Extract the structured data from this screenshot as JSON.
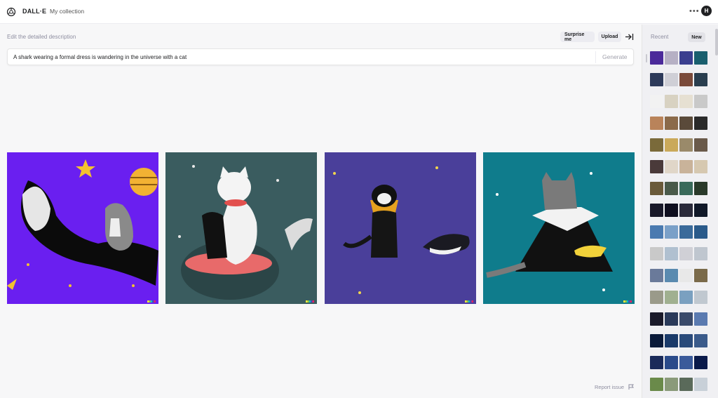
{
  "nav": {
    "brand": "DALL·E",
    "collection_link": "My collection",
    "avatar_initial": "H"
  },
  "editor": {
    "hint": "Edit the detailed description",
    "surprise_label": "Surprise me",
    "upload_label": "Upload",
    "prompt": "A shark wearing a formal dress is wandering in the universe with a cat",
    "generate_label": "Generate"
  },
  "results": [
    {
      "background": "#6a1ff0"
    },
    {
      "background": "#3a5c5f"
    },
    {
      "background": "#4a3f9a"
    },
    {
      "background": "#0f7c8c"
    }
  ],
  "footer": {
    "report_label": "Report issue"
  },
  "sidebar": {
    "recent_label": "Recent",
    "new_label": "New",
    "history_colors": [
      [
        "#4b2a9a",
        "#b6b0c4",
        "#3b3f8f",
        "#1a5f6e"
      ],
      [
        "#2d3a5a",
        "#cfcfd6",
        "#7a4a3a",
        "#2a3e4f"
      ],
      [
        "#f2f2f2",
        "#d8d2c2",
        "#e6e0d2",
        "#c9c9c9"
      ],
      [
        "#b9835a",
        "#8b6a4a",
        "#5a4a3a",
        "#2a2a2a"
      ],
      [
        "#7a6a3a",
        "#caa95a",
        "#9a8a6a",
        "#6a5a4a"
      ],
      [
        "#4a3a3a",
        "#e0d6c8",
        "#c9b39a",
        "#d6c8b0"
      ],
      [
        "#6a5a3a",
        "#4a5a4a",
        "#3a6a5a",
        "#2a3a2a"
      ],
      [
        "#1a1a2a",
        "#0f0f1f",
        "#2a2a3a",
        "#101828"
      ],
      [
        "#4a7ab0",
        "#7aa0c8",
        "#3a6a9a",
        "#2a5a8a"
      ],
      [
        "#c9c9c9",
        "#b0c0d0",
        "#d0d0d6",
        "#bfc6cf"
      ],
      [
        "#6a7a9a",
        "#5a8ab0",
        "#e8e8e8",
        "#7a6a4a"
      ],
      [
        "#9a9a8a",
        "#a0b090",
        "#7aa0c0",
        "#c0c8d0"
      ],
      [
        "#1a1a2a",
        "#2a3a5a",
        "#3a4a6a",
        "#5a7ab0"
      ],
      [
        "#0a1a3a",
        "#1a3a6a",
        "#2a4a7a",
        "#3a5a8a"
      ],
      [
        "#1a2a5a",
        "#2a4a8a",
        "#3a5a9a",
        "#0a1a4a"
      ],
      [
        "#6a8a4a",
        "#8a9a7a",
        "#5a6a5a",
        "#c8d0d8"
      ]
    ]
  }
}
